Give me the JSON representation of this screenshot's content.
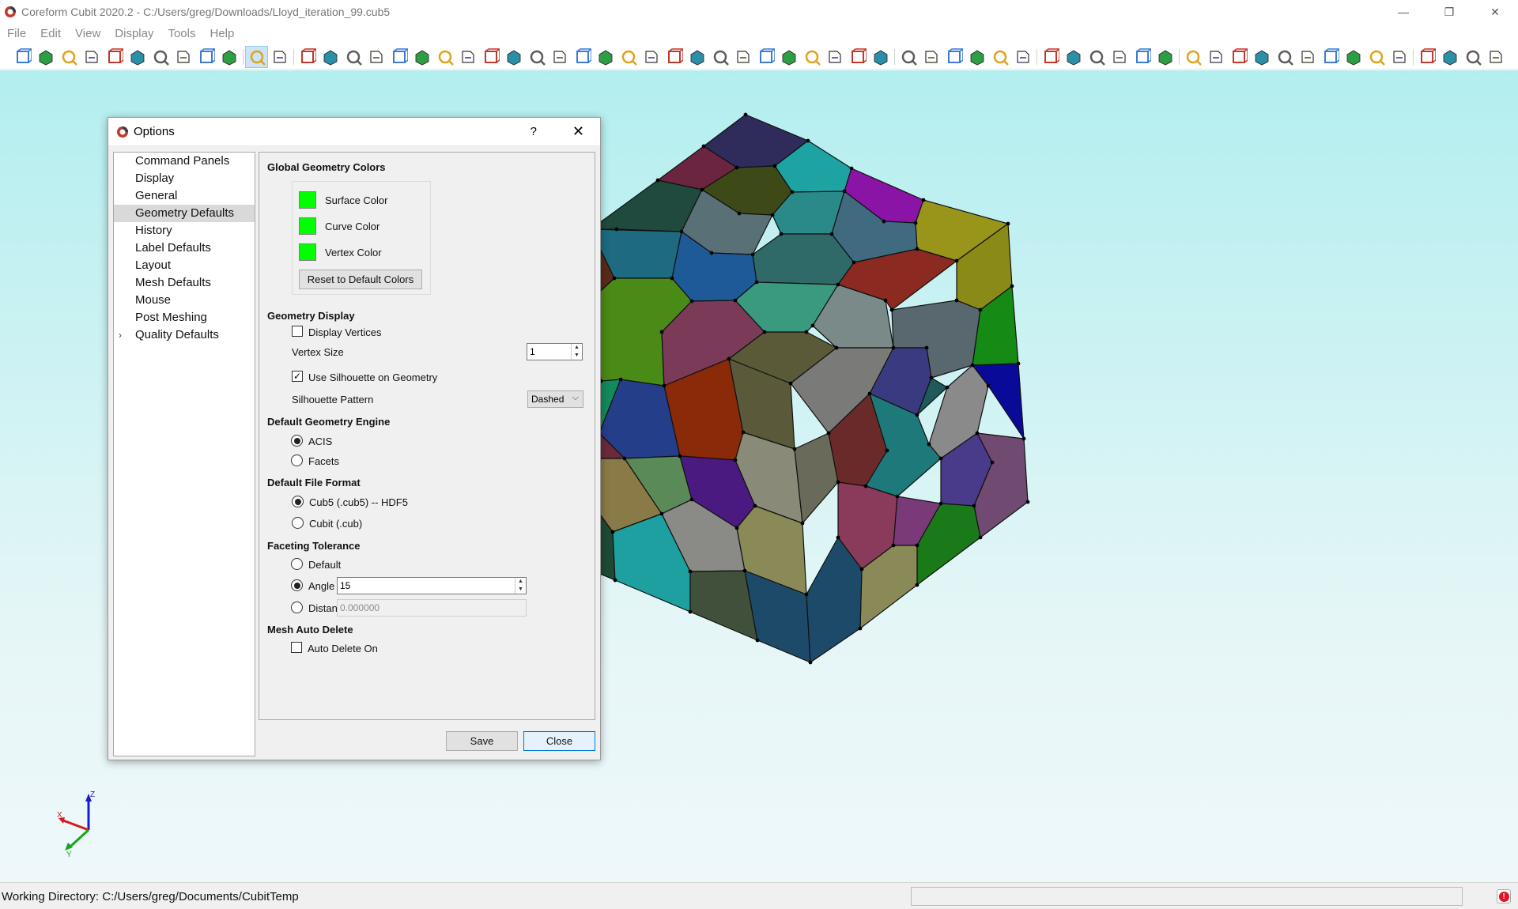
{
  "window": {
    "title": "Coreform Cubit 2020.2 - C:/Users/greg/Downloads/Lloyd_iteration_99.cub5",
    "minimize": "—",
    "restore": "❐",
    "close": "✕"
  },
  "menu": [
    "File",
    "Edit",
    "View",
    "Display",
    "Tools",
    "Help"
  ],
  "toolbar": {
    "groups": [
      [
        "new-file",
        "open-file",
        "save-file",
        "save-as",
        "export",
        "journal",
        "play-journal",
        "record",
        "stop",
        "tools"
      ],
      [
        "select",
        "undo"
      ],
      [
        "wireframe",
        "hidden-line",
        "smooth-shade",
        "flat-shade",
        "transparent",
        "surface-mesh",
        "volume-mesh",
        "lights",
        "grid",
        "perspective",
        "cut-plane",
        "refresh",
        "zoom-in",
        "zoom-out",
        "rotate",
        "box",
        "ruler",
        "box-solid",
        "box-outline",
        "sphere",
        "torus",
        "brick",
        "prism",
        "cylinder",
        "group",
        "union"
      ],
      [
        "mesh-vol",
        "mesh-surf",
        "mesh-curve",
        "mesh-face",
        "mesh-edge",
        "mesh-node"
      ],
      [
        "cross",
        "line",
        "square",
        "pyramid",
        "grid-icon",
        "box-small"
      ],
      [
        "measure",
        "table",
        "arrows",
        "ruler-flat",
        "thermometer",
        "stack",
        "a-italic",
        "v-italic",
        "line-flat",
        "dash"
      ],
      [
        "frame",
        "frame2",
        "more",
        "wand"
      ]
    ]
  },
  "dialog": {
    "title": "Options",
    "help": "?",
    "close": "✕",
    "nav": [
      {
        "label": "Command Panels"
      },
      {
        "label": "Display"
      },
      {
        "label": "General"
      },
      {
        "label": "Geometry Defaults",
        "selected": true
      },
      {
        "label": "History"
      },
      {
        "label": "Label Defaults"
      },
      {
        "label": "Layout"
      },
      {
        "label": "Mesh Defaults"
      },
      {
        "label": "Mouse"
      },
      {
        "label": "Post Meshing"
      },
      {
        "label": "Quality Defaults",
        "expandable": true
      }
    ],
    "content": {
      "global_colors_title": "Global Geometry Colors",
      "surface_color": "Surface Color",
      "curve_color": "Curve Color",
      "vertex_color": "Vertex Color",
      "swatch_color": "#00ff00",
      "reset_button": "Reset to Default Colors",
      "geometry_display_title": "Geometry Display",
      "display_vertices": "Display Vertices",
      "display_vertices_checked": false,
      "vertex_size_label": "Vertex Size",
      "vertex_size_value": "1",
      "use_silhouette": "Use Silhouette on Geometry",
      "use_silhouette_checked": true,
      "silhouette_pattern_label": "Silhouette Pattern",
      "silhouette_pattern_value": "Dashed",
      "engine_title": "Default Geometry Engine",
      "engine_acis": "ACIS",
      "engine_facets": "Facets",
      "engine_selected": "ACIS",
      "file_format_title": "Default File Format",
      "format_cub5": "Cub5 (.cub5) -- HDF5",
      "format_cub": "Cubit (.cub)",
      "format_selected": "Cub5",
      "faceting_title": "Faceting Tolerance",
      "faceting_default": "Default",
      "faceting_angle": "Angle",
      "faceting_angle_value": "15",
      "faceting_distance": "Distance",
      "faceting_distance_value": "0.000000",
      "faceting_selected": "Angle",
      "auto_delete_title": "Mesh Auto Delete",
      "auto_delete_label": "Auto Delete On",
      "auto_delete_checked": false
    },
    "save_button": "Save",
    "close_button": "Close"
  },
  "axis": {
    "x": "X",
    "y": "Y",
    "z": "Z"
  },
  "status": {
    "working_directory": "Working Directory: C:/Users/greg/Documents/CubitTemp",
    "error_icon": "!"
  }
}
